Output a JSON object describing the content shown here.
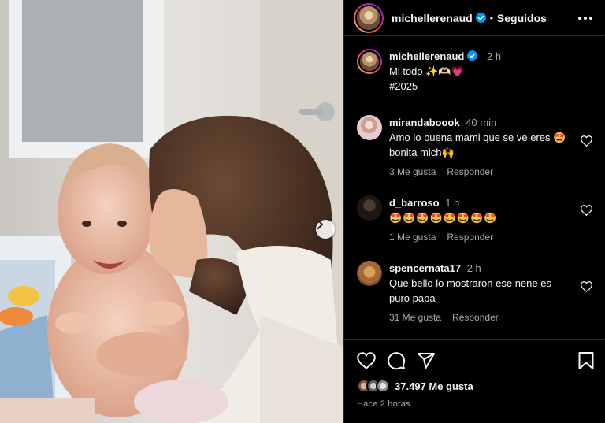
{
  "header": {
    "username": "michellerenaud",
    "separator": "•",
    "follow_status": "Seguidos"
  },
  "caption": {
    "username": "michellerenaud",
    "time": "2 h",
    "text": "Mi todo ✨🫶🏻💗",
    "hashtag": "#2025"
  },
  "comments": [
    {
      "username": "mirandaboook",
      "time": "40 min",
      "text": "Amo lo buena mami que se ve eres 🤩 bonita mich🙌",
      "likes": "3 Me gusta",
      "reply": "Responder"
    },
    {
      "username": "d_barroso",
      "time": "1 h",
      "text": "🤩🤩🤩🤩🤩🤩🤩🤩",
      "likes": "1 Me gusta",
      "reply": "Responder"
    },
    {
      "username": "spencernata17",
      "time": "2 h",
      "text": "Que bello lo mostraron ese nene es puro papa",
      "likes": "31 Me gusta",
      "reply": "Responder"
    }
  ],
  "post": {
    "like_count": "37.497 Me gusta",
    "posted_ago": "Hace 2 horas"
  },
  "icons": {
    "verified": "verified-badge-icon",
    "more": "more-options-icon",
    "next": "chevron-right-icon",
    "like": "heart-icon",
    "comment": "comment-bubble-icon",
    "share": "paper-plane-icon",
    "save": "bookmark-icon"
  },
  "colors": {
    "background": "#000000",
    "text": "#f5f5f5",
    "muted": "#a8a8a8",
    "verified": "#0095f6",
    "border": "#262626"
  }
}
